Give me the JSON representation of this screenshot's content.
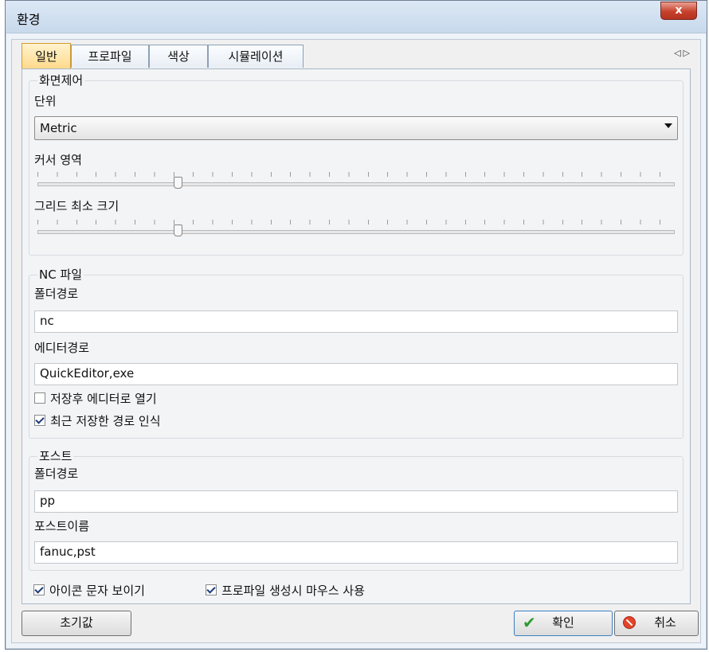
{
  "window": {
    "title": "환경",
    "close_glyph": "x"
  },
  "tabs": [
    {
      "label": "일반",
      "active": true
    },
    {
      "label": "프로파일",
      "active": false
    },
    {
      "label": "색상",
      "active": false
    },
    {
      "label": "시뮬레이션",
      "active": false
    }
  ],
  "tab_nav": {
    "prev_icon": "triangle-left-icon",
    "next_icon": "triangle-right-icon",
    "glyphs": "◁▷"
  },
  "display": {
    "title": "화면제어",
    "unit_label": "단위",
    "unit_value": "Metric",
    "cursor_label": "커서 영역",
    "cursor_level": 0.22,
    "grid_label": "그리드 최소 크기",
    "grid_level": 0.22
  },
  "nc": {
    "title": "NC 파일",
    "folder_label": "폴더경로",
    "folder_value": "nc",
    "editor_label": "에디터경로",
    "editor_value": "QuickEditor,exe",
    "open_after_save": {
      "label": "저장후 에디터로 열기",
      "checked": false
    },
    "remember_path": {
      "label": "최근 저장한 경로 인식",
      "checked": true
    }
  },
  "post": {
    "title": "포스트",
    "folder_label": "폴더경로",
    "folder_value": "pp",
    "name_label": "포스트이름",
    "name_value": "fanuc,pst"
  },
  "options": {
    "show_icon_text": {
      "label": "아이콘 문자 보이기",
      "checked": true
    },
    "mouse_on_profile": {
      "label": "프로파일 생성시 마우스 사용",
      "checked": true
    }
  },
  "buttons": {
    "reset": "초기값",
    "ok": "확인",
    "cancel": "취소"
  },
  "colors": {
    "active_tab": "#ffd98a",
    "close": "#c7412c",
    "ok_icon": "#2e9a2e",
    "cancel_icon": "#e2452a"
  }
}
